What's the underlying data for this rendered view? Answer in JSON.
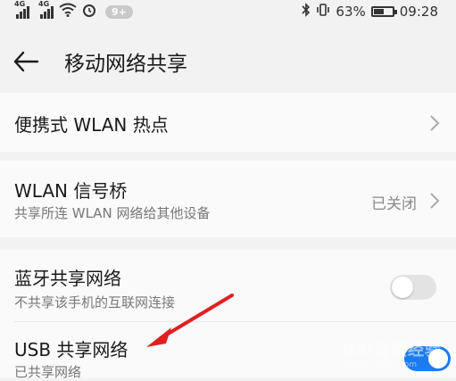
{
  "status_bar": {
    "sim1_label": "4G",
    "sim2_label": "4G",
    "notification_count": "9+",
    "battery_percent": "63%",
    "battery_level": 0.63,
    "time": "09:28",
    "icons": [
      "signal-icon",
      "signal-icon",
      "wifi-icon",
      "alarm-icon",
      "bluetooth-icon",
      "vibrate-icon",
      "battery-icon"
    ]
  },
  "header": {
    "title": "移动网络共享",
    "back_icon": "back-arrow-icon"
  },
  "settings": {
    "hotspot": {
      "title": "便携式 WLAN 热点"
    },
    "bridge": {
      "title": "WLAN 信号桥",
      "subtitle": "共享所连 WLAN 网络给其他设备",
      "value": "已关闭"
    },
    "bluetooth": {
      "title": "蓝牙共享网络",
      "subtitle": "不共享该手机的互联网连接",
      "enabled": false
    },
    "usb": {
      "title": "USB 共享网络",
      "subtitle": "已共享网络",
      "enabled": true
    }
  },
  "colors": {
    "background": "#f2f2f2",
    "card": "#fafafa",
    "toggle_on": "#1d7bf0",
    "annotation_arrow": "#e02020"
  },
  "watermark": {
    "text": "Bai百度经验",
    "small": "jingyan.baidu.com"
  }
}
